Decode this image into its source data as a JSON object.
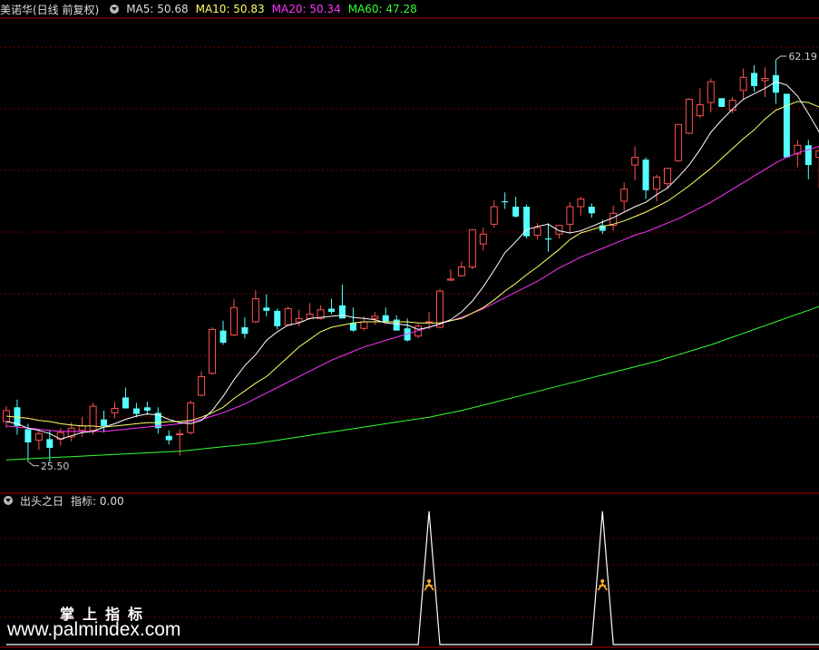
{
  "main_header": {
    "stock": "美诺华(日线 前复权)",
    "ma5_label": "MA5: 50.68",
    "ma10_label": "MA10: 50.83",
    "ma20_label": "MA20: 50.34",
    "ma60_label": "MA60: 47.28"
  },
  "indicator_header": {
    "name": "出头之日",
    "value_label": "指标: 0.00"
  },
  "watermark": {
    "line1": "掌上指标",
    "line2": "www.palmindex.com"
  },
  "colors": {
    "up": "#ff5050",
    "down": "#54ffff",
    "ma5": "#ffffff",
    "ma10": "#ffff66",
    "ma20": "#ff33ff",
    "ma60": "#33ff33",
    "grid": "#7a0000",
    "indicator": "#ffffff",
    "signal": "#ffb020"
  },
  "chart_data": [
    {
      "type": "candlestick",
      "title": "美诺华(日线 前复权)",
      "ylim": [
        23,
        66
      ],
      "max_marker": "62.19",
      "min_marker": "25.50",
      "candles": [
        [
          29.2,
          30.6,
          28.6,
          30.2
        ],
        [
          30.5,
          31.2,
          28.0,
          28.8
        ],
        [
          28.5,
          29.0,
          25.5,
          27.3
        ],
        [
          27.5,
          28.5,
          26.6,
          28.1
        ],
        [
          27.6,
          28.4,
          25.5,
          26.8
        ],
        [
          27.6,
          28.6,
          27.0,
          28.2
        ],
        [
          27.8,
          29.1,
          27.4,
          28.6
        ],
        [
          28.4,
          29.6,
          27.8,
          28.8
        ],
        [
          28.4,
          30.9,
          28.0,
          30.6
        ],
        [
          29.4,
          30.2,
          28.2,
          28.8
        ],
        [
          30.0,
          31.0,
          29.5,
          30.4
        ],
        [
          31.4,
          32.3,
          30.6,
          30.4
        ],
        [
          30.4,
          30.9,
          29.6,
          29.9
        ],
        [
          30.5,
          31.0,
          29.8,
          30.2
        ],
        [
          30.0,
          30.5,
          28.1,
          28.6
        ],
        [
          27.9,
          28.4,
          27.1,
          27.5
        ],
        [
          28.0,
          28.5,
          26.1,
          28.1
        ],
        [
          28.2,
          31.1,
          28.0,
          30.9
        ],
        [
          31.6,
          33.8,
          31.5,
          33.3
        ],
        [
          33.6,
          37.8,
          33.5,
          37.6
        ],
        [
          37.5,
          38.4,
          36.2,
          36.4
        ],
        [
          37.1,
          40.4,
          37.0,
          39.6
        ],
        [
          37.8,
          38.7,
          36.8,
          37.2
        ],
        [
          38.3,
          41.2,
          38.2,
          40.4
        ],
        [
          39.6,
          40.8,
          38.8,
          39.3
        ],
        [
          39.3,
          39.5,
          37.6,
          37.9
        ],
        [
          38.0,
          39.7,
          37.9,
          39.5
        ],
        [
          38.3,
          39.4,
          37.9,
          38.6
        ],
        [
          38.6,
          40.0,
          38.5,
          39.0
        ],
        [
          38.6,
          39.8,
          38.5,
          39.4
        ],
        [
          39.5,
          40.4,
          39.0,
          39.2
        ],
        [
          39.8,
          41.7,
          38.8,
          38.6
        ],
        [
          38.2,
          39.6,
          37.4,
          37.5
        ],
        [
          37.7,
          38.8,
          37.5,
          38.3
        ],
        [
          38.6,
          39.2,
          38.0,
          38.8
        ],
        [
          38.9,
          39.6,
          38.6,
          38.3
        ],
        [
          38.5,
          38.9,
          37.6,
          37.5
        ],
        [
          37.7,
          38.6,
          36.5,
          36.6
        ],
        [
          37.0,
          38.1,
          36.8,
          37.9
        ],
        [
          38.3,
          39.2,
          37.6,
          38.3
        ],
        [
          37.8,
          41.3,
          37.7,
          41.1
        ],
        [
          42.1,
          43.1,
          42.0,
          42.2
        ],
        [
          42.5,
          43.8,
          42.4,
          43.3
        ],
        [
          43.3,
          46.7,
          43.1,
          46.7
        ],
        [
          45.4,
          46.9,
          44.8,
          46.3
        ],
        [
          47.2,
          49.4,
          46.9,
          48.8
        ],
        [
          49.3,
          50.1,
          48.6,
          49.2
        ],
        [
          48.8,
          49.7,
          47.8,
          47.9
        ],
        [
          48.8,
          49.0,
          45.9,
          46.1
        ],
        [
          46.2,
          47.3,
          45.8,
          46.9
        ],
        [
          45.9,
          47.3,
          44.7,
          45.8
        ],
        [
          46.3,
          47.1,
          45.9,
          47.1
        ],
        [
          47.2,
          49.2,
          46.3,
          48.8
        ],
        [
          48.8,
          49.7,
          48.0,
          49.5
        ],
        [
          48.8,
          49.1,
          47.8,
          48.2
        ],
        [
          47.1,
          47.6,
          46.3,
          46.6
        ],
        [
          47.1,
          48.9,
          46.6,
          48.2
        ],
        [
          49.3,
          51.0,
          48.4,
          50.4
        ],
        [
          52.6,
          54.3,
          51.2,
          53.3
        ],
        [
          53.1,
          53.3,
          49.5,
          50.3
        ],
        [
          50.4,
          51.7,
          49.3,
          51.5
        ],
        [
          50.9,
          52.3,
          50.4,
          52.3
        ],
        [
          53.0,
          56.3,
          52.9,
          56.3
        ],
        [
          55.5,
          58.7,
          55.4,
          58.6
        ],
        [
          57.1,
          59.6,
          56.9,
          58.1
        ],
        [
          58.3,
          60.5,
          57.4,
          60.2
        ],
        [
          58.7,
          58.6,
          57.9,
          57.9
        ],
        [
          57.6,
          58.8,
          57.3,
          58.5
        ],
        [
          59.4,
          61.4,
          58.6,
          60.6
        ],
        [
          61.0,
          61.7,
          59.3,
          59.8
        ],
        [
          60.3,
          61.5,
          58.8,
          60.5
        ],
        [
          60.8,
          62.2,
          58.2,
          59.2
        ],
        [
          59.1,
          59.1,
          53.3,
          53.3
        ],
        [
          53.6,
          54.9,
          52.4,
          54.4
        ],
        [
          54.4,
          54.9,
          51.3,
          52.6
        ],
        [
          53.3,
          54.4,
          50.5,
          53.9
        ]
      ],
      "ma5": [
        29.2,
        29.0,
        28.6,
        28.4,
        28.1,
        27.6,
        27.9,
        28.2,
        28.3,
        28.7,
        29.0,
        29.4,
        29.7,
        29.9,
        29.8,
        29.4,
        29.1,
        29.0,
        29.3,
        30.2,
        31.5,
        33.0,
        34.3,
        35.3,
        36.6,
        37.4,
        38.0,
        38.2,
        38.6,
        38.7,
        38.8,
        38.9,
        38.7,
        38.6,
        38.5,
        38.2,
        38.1,
        38.0,
        37.6,
        37.8,
        38.1,
        38.5,
        39.2,
        40.2,
        41.5,
        43.0,
        44.6,
        45.6,
        46.7,
        47.0,
        47.2,
        46.6,
        46.4,
        46.6,
        47.0,
        47.4,
        47.8,
        48.3,
        48.8,
        49.2,
        49.9,
        50.5,
        51.5,
        52.6,
        54.0,
        55.6,
        56.7,
        57.7,
        58.6,
        59.1,
        59.6,
        60.2,
        59.9,
        58.9,
        57.3,
        55.6
      ],
      "ma10": [
        29.7,
        29.6,
        29.5,
        29.3,
        29.2,
        29.0,
        28.9,
        28.8,
        28.8,
        28.7,
        28.8,
        28.9,
        29.0,
        29.1,
        29.1,
        29.2,
        29.2,
        29.3,
        29.6,
        30.0,
        30.5,
        31.3,
        32.0,
        32.7,
        33.3,
        34.2,
        35.1,
        36.0,
        36.7,
        37.4,
        37.8,
        38.0,
        38.2,
        38.3,
        38.3,
        38.3,
        38.3,
        38.3,
        38.2,
        38.2,
        38.2,
        38.4,
        38.6,
        39.1,
        39.6,
        40.3,
        41.1,
        41.8,
        42.6,
        43.3,
        44.1,
        44.9,
        45.8,
        46.4,
        46.7,
        47.0,
        47.2,
        47.5,
        47.9,
        48.3,
        48.8,
        49.3,
        50.0,
        50.7,
        51.5,
        52.3,
        53.2,
        54.1,
        55.0,
        55.8,
        56.8,
        57.6,
        58.0,
        58.4,
        58.3,
        57.9
      ],
      "ma20": [
        28.8,
        28.7,
        28.6,
        28.5,
        28.4,
        28.3,
        28.3,
        28.3,
        28.3,
        28.3,
        28.4,
        28.5,
        28.6,
        28.7,
        28.8,
        28.9,
        29.0,
        29.2,
        29.4,
        29.7,
        30.0,
        30.4,
        30.8,
        31.3,
        31.8,
        32.3,
        32.8,
        33.3,
        33.8,
        34.3,
        34.8,
        35.2,
        35.6,
        36.0,
        36.3,
        36.6,
        36.9,
        37.2,
        37.5,
        37.8,
        38.1,
        38.4,
        38.7,
        39.1,
        39.5,
        40.0,
        40.5,
        41.0,
        41.5,
        42.0,
        42.6,
        43.2,
        43.7,
        44.2,
        44.6,
        45.0,
        45.4,
        45.8,
        46.2,
        46.5,
        46.9,
        47.3,
        47.7,
        48.2,
        48.7,
        49.2,
        49.8,
        50.4,
        51.0,
        51.6,
        52.2,
        52.8,
        53.3,
        53.7,
        54.0,
        54.3
      ],
      "ma60": [
        25.7,
        25.75,
        25.8,
        25.85,
        25.9,
        25.95,
        26.0,
        26.05,
        26.1,
        26.15,
        26.2,
        26.25,
        26.3,
        26.35,
        26.4,
        26.45,
        26.5,
        26.6,
        26.7,
        26.8,
        26.9,
        27.0,
        27.1,
        27.2,
        27.35,
        27.5,
        27.65,
        27.8,
        27.95,
        28.1,
        28.25,
        28.4,
        28.55,
        28.7,
        28.85,
        29.0,
        29.15,
        29.3,
        29.45,
        29.6,
        29.8,
        30.0,
        30.2,
        30.45,
        30.7,
        30.95,
        31.2,
        31.45,
        31.7,
        31.95,
        32.2,
        32.45,
        32.7,
        32.95,
        33.2,
        33.45,
        33.7,
        33.95,
        34.2,
        34.45,
        34.7,
        35.0,
        35.3,
        35.6,
        35.9,
        36.2,
        36.55,
        36.9,
        37.25,
        37.6,
        37.95,
        38.3,
        38.65,
        39.0,
        39.35,
        39.7
      ]
    },
    {
      "type": "line",
      "title": "出头之日",
      "ylim": [
        0,
        1
      ],
      "signals": [
        39,
        55
      ],
      "values_note_free": true
    }
  ]
}
